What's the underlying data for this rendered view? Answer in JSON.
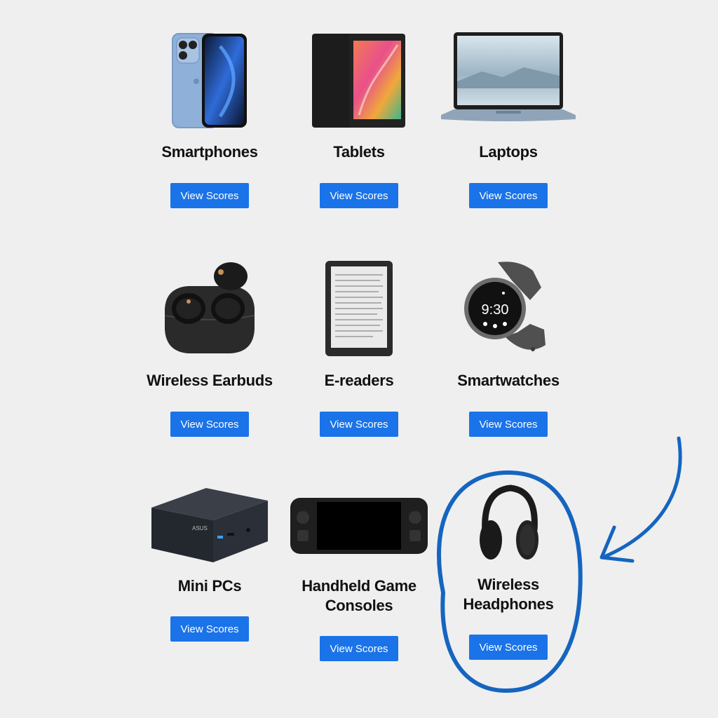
{
  "products": [
    {
      "id": "smartphones",
      "title": "Smartphones",
      "button": "View Scores",
      "icon": "smartphone-icon"
    },
    {
      "id": "tablets",
      "title": "Tablets",
      "button": "View Scores",
      "icon": "tablet-icon"
    },
    {
      "id": "laptops",
      "title": "Laptops",
      "button": "View Scores",
      "icon": "laptop-icon"
    },
    {
      "id": "wireless-earbuds",
      "title": "Wireless Earbuds",
      "button": "View Scores",
      "icon": "earbuds-icon"
    },
    {
      "id": "e-readers",
      "title": "E-readers",
      "button": "View Scores",
      "icon": "ereader-icon"
    },
    {
      "id": "smartwatches",
      "title": "Smartwatches",
      "button": "View Scores",
      "icon": "smartwatch-icon",
      "watch_time": "9:30"
    },
    {
      "id": "mini-pcs",
      "title": "Mini PCs",
      "button": "View Scores",
      "icon": "mini-pc-icon",
      "brand": "ASUS"
    },
    {
      "id": "handheld-game-consoles",
      "title": "Handheld Game Consoles",
      "title_line1": "Handheld Game",
      "title_line2": "Consoles",
      "button": "View Scores",
      "icon": "game-console-icon"
    },
    {
      "id": "wireless-headphones",
      "title": "Wireless Headphones",
      "title_line1": "Wireless",
      "title_line2": "Headphones",
      "button": "View Scores",
      "icon": "headphones-icon",
      "highlighted": true
    }
  ],
  "colors": {
    "background": "#efefef",
    "button": "#1a73e8",
    "button_text": "#ffffff",
    "annotation": "#1565c0",
    "title": "#111111"
  }
}
